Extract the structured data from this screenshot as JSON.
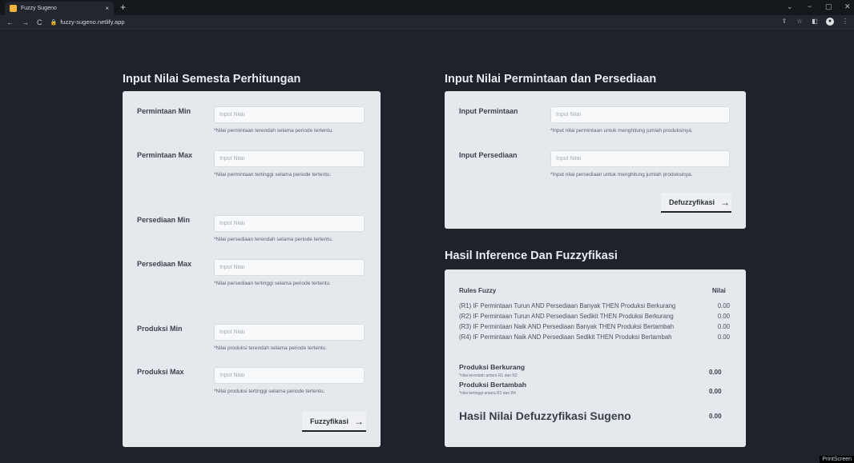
{
  "browser": {
    "tab_title": "Fuzzy Sugeno",
    "tab_close": "×",
    "new_tab": "+",
    "url": "fuzzy-sugeno.netlify.app",
    "back": "←",
    "forward": "→",
    "reload": "C",
    "win_controls": [
      "⌄",
      "−",
      "▢",
      "✕"
    ]
  },
  "left_section": {
    "title": "Input Nilai Semesta Perhitungan",
    "rows": [
      {
        "label": "Permintaan Min",
        "placeholder": "Input Nilai",
        "value": "",
        "help": "*Nilai permintaan terendah selama periode tertentu."
      },
      {
        "label": "Permintaan Max",
        "placeholder": "Input Nilai",
        "value": "",
        "help": "*Nilai permintaan tertinggi selama periode tertentu."
      },
      {
        "label": "Persediaan Min",
        "placeholder": "Input Nilai",
        "value": "",
        "help": "*Nilai persediaan terendah selama periode tertentu."
      },
      {
        "label": "Persediaan Max",
        "placeholder": "Input Nilai",
        "value": "",
        "help": "*Nilai persediaan tertinggi selama periode tertentu."
      },
      {
        "label": "Produksi Min",
        "placeholder": "Input Nilai",
        "value": "",
        "help": "*Nilai produksi terendah selama periode tertentu."
      },
      {
        "label": "Produksi Max",
        "placeholder": "Input Nilai",
        "value": "",
        "help": "*Nilai produksi tertinggi selama periode tertentu."
      }
    ],
    "button": "Fuzzyfikasi",
    "button_arrow": "→"
  },
  "right_section": {
    "title": "Input Nilai Permintaan dan Persediaan",
    "rows": [
      {
        "label": "Input Permintaan",
        "placeholder": "Input Nilai",
        "value": "",
        "help": "*Input nilai permintaan untuk menghitung jumlah produksinya."
      },
      {
        "label": "Input Persediaan",
        "placeholder": "Input Nilai",
        "value": "",
        "help": "*Input nilai persediaan untuk menghitung jumlah produksinya."
      }
    ],
    "button": "Defuzzyfikasi",
    "button_arrow": "→"
  },
  "results": {
    "title": "Hasil Inference Dan Fuzzyfikasi",
    "rules_header": "Rules Fuzzy",
    "value_header": "Nilai",
    "rules": [
      {
        "text": "(R1) IF Permintaan Turun AND Persediaan Banyak THEN Produksi Berkurang",
        "value": "0.00"
      },
      {
        "text": "(R2) IF Permintaan Turun AND Persediaan Sedikit THEN Produksi Berkurang",
        "value": "0.00"
      },
      {
        "text": "(R3) IF Permintaan Naik AND Persediaan Banyak THEN Produksi Bertambah",
        "value": "0.00"
      },
      {
        "text": "(R4) IF Permintaan Naik AND Persediaan Sedikit THEN Produksi Bertambah",
        "value": "0.00"
      }
    ],
    "berkurang_label": "Produksi Berkurang",
    "berkurang_note": "*nilai terendah antara R1 dan R2",
    "berkurang_value": "0.00",
    "bertambah_label": "Produksi Bertambah",
    "bertambah_note": "*nilai tertinggi antara R3 dan R4",
    "bertambah_value": "0.00",
    "final_label": "Hasil Nilai Defuzzyfikasi Sugeno",
    "final_value": "0.00"
  },
  "overlay": "PrintScreen"
}
